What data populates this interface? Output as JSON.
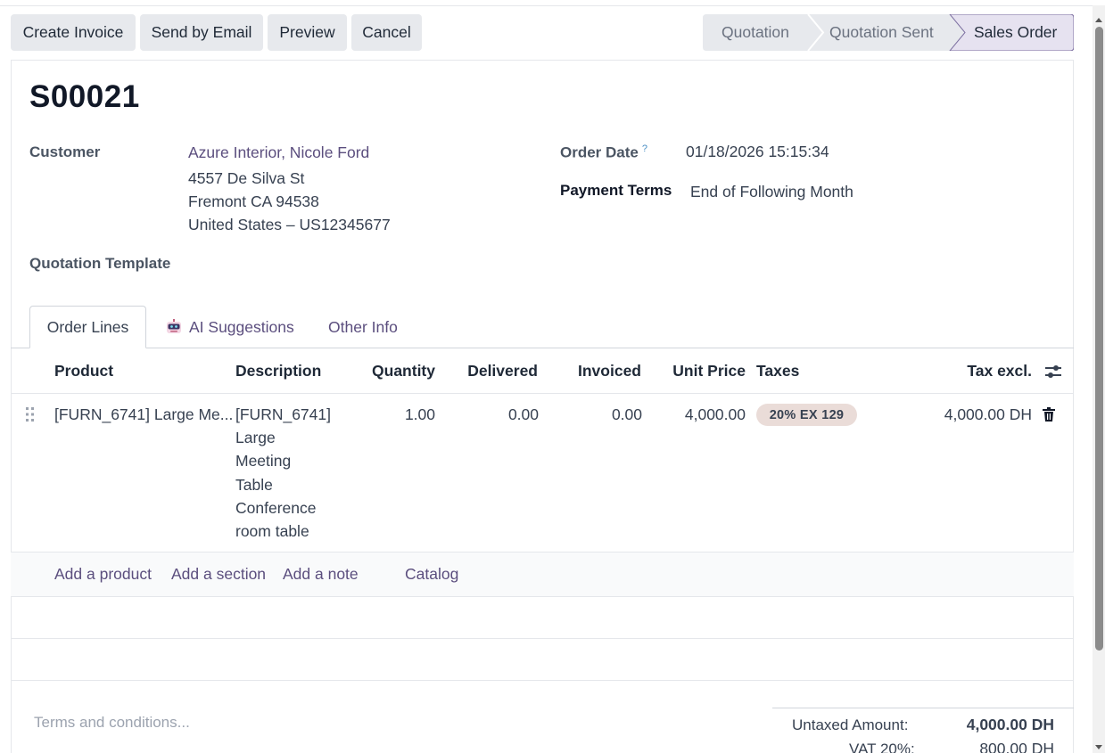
{
  "actions": {
    "create_invoice": "Create Invoice",
    "send_by_email": "Send by Email",
    "preview": "Preview",
    "cancel": "Cancel"
  },
  "status": {
    "stages": [
      "Quotation",
      "Quotation Sent",
      "Sales Order"
    ],
    "active": "Sales Order"
  },
  "record": {
    "title": "S00021",
    "customer_label": "Customer",
    "customer_name": "Azure Interior, Nicole Ford",
    "address_line1": "4557 De Silva St",
    "address_line2": "Fremont CA 94538",
    "address_line3": "United States – US12345677",
    "order_date_label": "Order Date",
    "order_date_help": "?",
    "order_date": "01/18/2026 15:15:34",
    "payment_terms_label": "Payment Terms",
    "payment_terms": "End of Following Month",
    "quotation_template_label": "Quotation Template"
  },
  "tabs": {
    "order_lines": "Order Lines",
    "ai_suggestions": "AI Suggestions",
    "other_info": "Other Info"
  },
  "table": {
    "headers": {
      "product": "Product",
      "description": "Description",
      "quantity": "Quantity",
      "delivered": "Delivered",
      "invoiced": "Invoiced",
      "unit_price": "Unit Price",
      "taxes": "Taxes",
      "tax_excl": "Tax excl."
    },
    "rows": [
      {
        "product": "[FURN_6741] Large Me...",
        "description_lines": [
          "[FURN_6741]",
          "Large",
          "Meeting",
          "Table",
          "Conference",
          "room table"
        ],
        "quantity": "1.00",
        "delivered": "0.00",
        "invoiced": "0.00",
        "unit_price": "4,000.00",
        "tax": "20% EX 129",
        "subtotal": "4,000.00 DH"
      }
    ],
    "add_product": "Add a product",
    "add_section": "Add a section",
    "add_note": "Add a note",
    "catalog": "Catalog"
  },
  "footer": {
    "terms_placeholder": "Terms and conditions...",
    "untaxed_label": "Untaxed Amount:",
    "untaxed_value": "4,000.00 DH",
    "vat_label": "VAT 20%:",
    "vat_value": "800.00 DH"
  }
}
